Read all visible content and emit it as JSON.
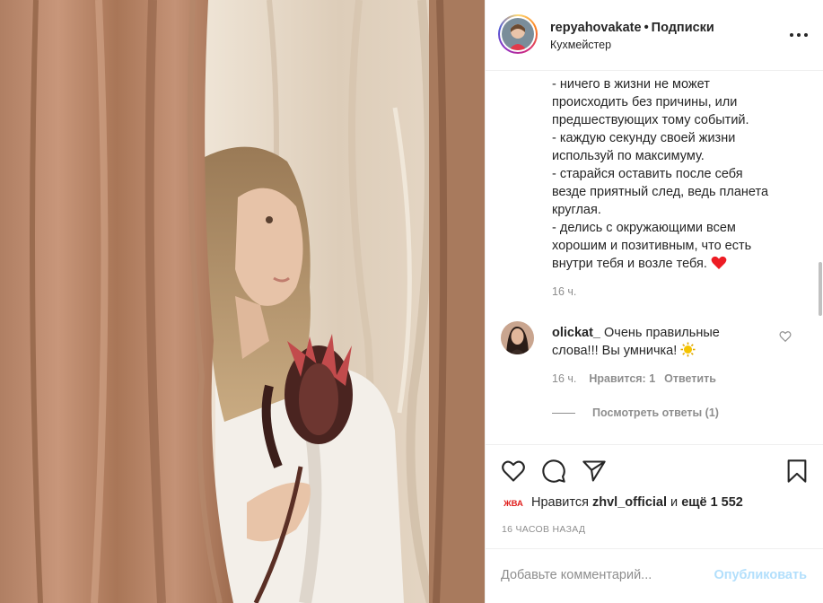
{
  "post": {
    "username": "repyahovakate",
    "separator": "•",
    "follow_status": "Подписки",
    "location": "Кухмейстер"
  },
  "caption": {
    "lines": [
      "- ничего в жизни не может",
      "происходить без причины, или",
      "предшествующих тому событий.",
      "- каждую секунду своей жизни",
      "используй по максимуму.",
      "- старайся оставить после себя",
      "везде приятный след, ведь планета",
      "круглая.",
      "- делись с окружающими всем",
      "хорошим и позитивным, что есть",
      "внутри тебя и возле тебя."
    ],
    "time": "16 ч."
  },
  "comment": {
    "username": "olickat_",
    "text": "Очень правильные слова!!! Вы умничка!",
    "time": "16 ч.",
    "likes_label": "Нравится: 1",
    "reply_label": "Ответить",
    "view_replies": "Посмотреть ответы (1)"
  },
  "likes": {
    "prefix": "Нравится",
    "user": "zhvl_official",
    "conjunction": "и",
    "others": "ещё 1 552",
    "badge_text": "ЖВА"
  },
  "time_ago": "16 ЧАСОВ НАЗАД",
  "add_comment": {
    "placeholder": "Добавьте комментарий...",
    "publish_label": "Опубликовать"
  },
  "icons": {
    "like": "heart-outline-icon",
    "comment": "speech-bubble-icon",
    "share": "paper-plane-icon",
    "save": "bookmark-icon",
    "more": "three-dots-icon",
    "emoji_heart": "red-heart-emoji",
    "emoji_sun": "sun-emoji"
  },
  "colors": {
    "text": "#262626",
    "secondary": "#8e8e8e",
    "publish_disabled": "#b2dffc",
    "heart_red": "#ed1c24",
    "badge_red": "#e0201e"
  }
}
